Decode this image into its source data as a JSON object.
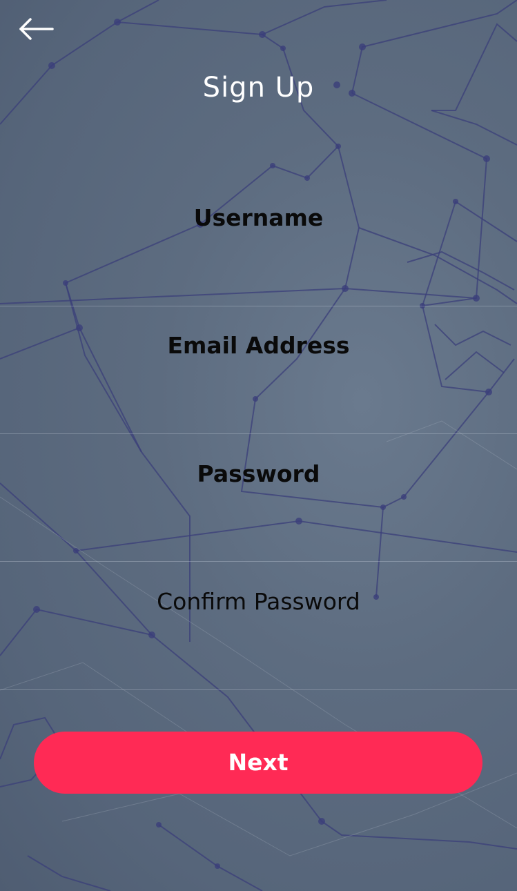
{
  "header": {
    "title": "Sign Up",
    "back_icon": "arrow-left-icon"
  },
  "form": {
    "fields": [
      {
        "label": "Username",
        "value": "",
        "placeholder": ""
      },
      {
        "label": "Email Address",
        "value": "",
        "placeholder": ""
      },
      {
        "label": "Password",
        "value": "",
        "placeholder": ""
      },
      {
        "label": "Confirm Password",
        "value": "",
        "placeholder": ""
      }
    ],
    "next_label": "Next"
  },
  "colors": {
    "accent": "#ff2a55",
    "background": "#5d6c80",
    "text": "#0a0a0a",
    "title": "#ffffff"
  }
}
